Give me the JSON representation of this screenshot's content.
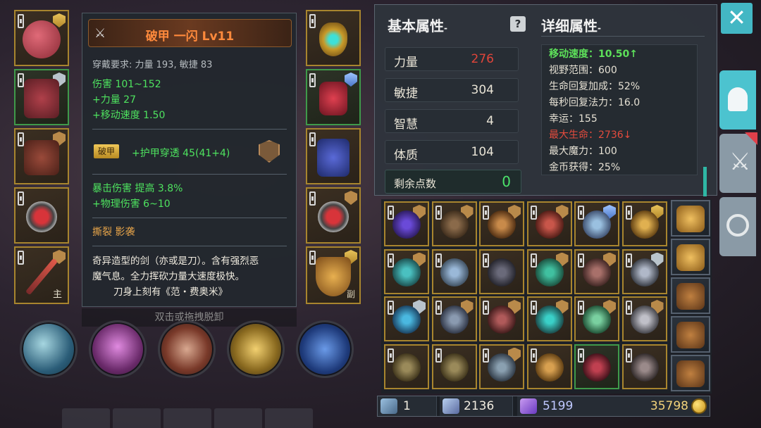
{
  "tooltip": {
    "title": "破甲 一闪 Lv11",
    "requirement": "穿戴要求:  力量 193, 敏捷 83",
    "damage": "伤害  101~152",
    "bonus_str": "+力量 27",
    "bonus_move": "+移动速度 1.50",
    "tag": "破甲",
    "armor_pen": "+护甲穿透 45(41+4)",
    "crit": "暴击伤害 提高 3.8%",
    "phys": "+物理伤害 6~10",
    "skills_line": "撕裂   影袭",
    "desc1": "奇异造型的剑（亦或是刀）。含有强烈恶",
    "desc2": "魔气息。全力挥砍力量大速度极快。",
    "desc3": "刀身上刻有《范・费奥米》"
  },
  "unequip_hint": "双击或拖拽脱卸",
  "main_hand_mark": "主",
  "offhand_mark": "副",
  "attributes": {
    "basic_title": "基本属性",
    "detail_title": "详细属性",
    "stats": [
      {
        "label": "力量",
        "value": "276"
      },
      {
        "label": "敏捷",
        "value": "304"
      },
      {
        "label": "智慧",
        "value": "4"
      },
      {
        "label": "体质",
        "value": "104"
      }
    ],
    "points_label": "剩余点数",
    "points_value": "0",
    "details": [
      "移动速度：10.50↑",
      "视野范围：600",
      "生命回复加成：52%",
      "每秒回复法力：16.0",
      "幸运：155",
      "最大生命：2736↓",
      "最大魔力：100",
      "金币获得：25%"
    ]
  },
  "currency": {
    "keys": "1",
    "souls": "2136",
    "crystals": "5199",
    "gold": "35798"
  },
  "colors": {
    "accent": "#43b7c4",
    "slot_gold": "#a8852e",
    "slot_green": "#3f9a4a",
    "positive": "#4ee35f",
    "negative": "#e0453a",
    "legend": "#ff8a3c"
  }
}
